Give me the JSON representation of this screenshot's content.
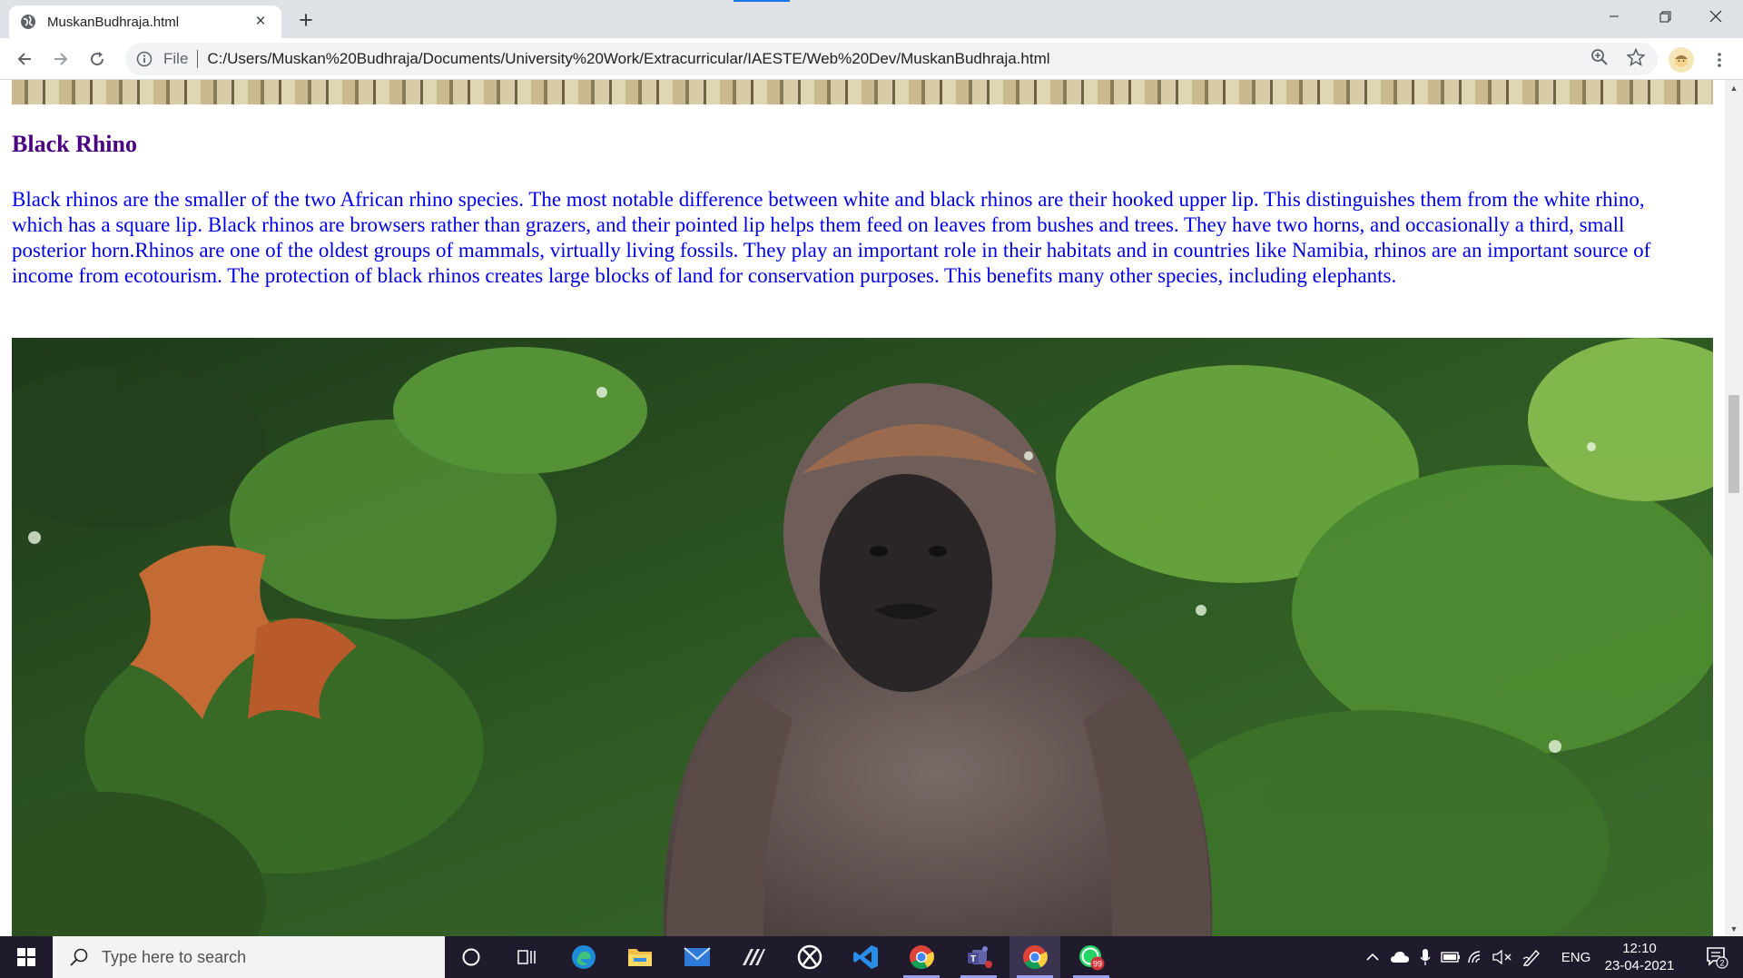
{
  "browser": {
    "tab_title": "MuskanBudhraja.html",
    "new_tab_symbol": "+",
    "close_symbol": "×",
    "url_scheme_label": "File",
    "url": "C:/Users/Muskan%20Budhraja/Documents/University%20Work/Extracurricular/IAESTE/Web%20Dev/MuskanBudhraja.html",
    "icons": [
      "globe-icon",
      "back-icon",
      "forward-icon",
      "reload-icon",
      "info-icon",
      "zoom-icon",
      "star-icon",
      "avatar",
      "menu-icon",
      "minimize-icon",
      "maximize-icon",
      "close-icon"
    ]
  },
  "page": {
    "heading": "Black Rhino",
    "paragraph": "Black rhinos are the smaller of the two African rhino species. The most notable difference between white and black rhinos are their hooked upper lip. This distinguishes them from the white rhino, which has a square lip. Black rhinos are browsers rather than grazers, and their pointed lip helps them feed on leaves from bushes and trees. They have two horns, and occasionally a third, small posterior horn.Rhinos are one of the oldest groups of mammals, virtually living fossils. They play an important role in their habitats and in countries like Namibia, rhinos are an important source of income from ecotourism. The protection of black rhinos creates large blocks of land for conservation purposes. This benefits many other species, including elephants.",
    "heading_color": "#4b0082",
    "text_color": "#0000e6"
  },
  "taskbar": {
    "search_placeholder": "Type here to search",
    "whatsapp_badge": "99",
    "language": "ENG",
    "time": "12:10",
    "date": "23-04-2021",
    "notification_count": "2",
    "apps": [
      "cortana-icon",
      "task-view-icon",
      "edge-icon",
      "file-explorer-icon",
      "mail-icon",
      "pen-app-icon",
      "xbox-icon",
      "vscode-icon",
      "chrome-icon",
      "teams-icon",
      "chrome-icon",
      "whatsapp-icon"
    ]
  }
}
